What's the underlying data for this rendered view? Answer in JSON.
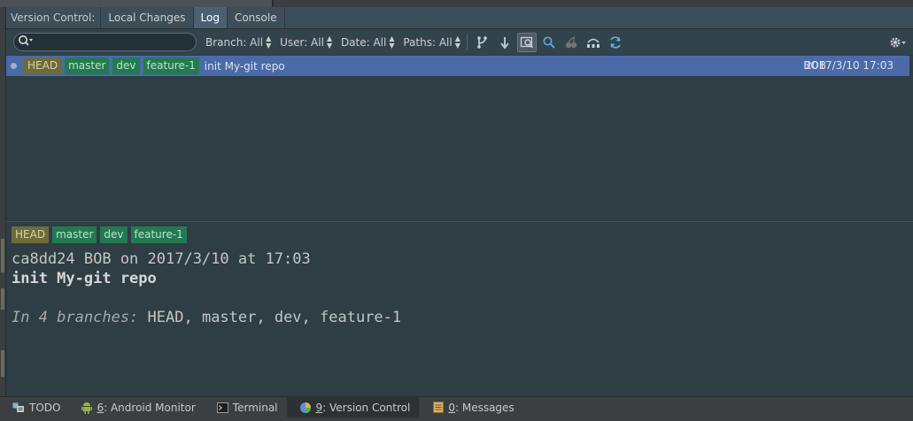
{
  "colors": {
    "selected_row": "#4a6aa8",
    "head_label": "#6f6a3a",
    "branch_label": "#237a50",
    "panel_bg": "#2f3d44",
    "tab_active": "#4a6174"
  },
  "tabs": {
    "title": "Version Control:",
    "items": [
      {
        "label": "Local Changes",
        "active": false
      },
      {
        "label": "Log",
        "active": true
      },
      {
        "label": "Console",
        "active": false
      }
    ]
  },
  "toolbar": {
    "search": {
      "value": "",
      "placeholder": ""
    },
    "filters": {
      "branch": "Branch: All",
      "user": "User: All",
      "date": "Date: All",
      "paths": "Paths: All"
    },
    "icons": [
      "branch-graph-icon",
      "sort-down-icon",
      "preview-icon",
      "find-icon",
      "cherry-pick-icon",
      "intellisort-icon",
      "refresh-icon",
      "settings-gear-icon"
    ]
  },
  "log": {
    "commits": [
      {
        "labels": {
          "head": "HEAD",
          "branches": [
            "master",
            "dev",
            "feature-1"
          ]
        },
        "message": "init My-git repo",
        "author": "BOB",
        "date": "2017/3/10 17:03"
      }
    ]
  },
  "details": {
    "labels": {
      "head": "HEAD",
      "branches": [
        "master",
        "dev",
        "feature-1"
      ]
    },
    "hash_line": "ca8dd24 BOB on 2017/3/10 at 17:03",
    "subject": "init My-git repo",
    "branches_prefix": "In 4 branches:",
    "branches_list": "HEAD, master, dev, feature-1"
  },
  "bottom_bar": {
    "items": [
      {
        "key": "",
        "label": "TODO",
        "active": false
      },
      {
        "key": "6",
        "label": ": Android Monitor",
        "active": false
      },
      {
        "key": "",
        "label": "Terminal",
        "active": false
      },
      {
        "key": "9",
        "label": ": Version Control",
        "active": true
      },
      {
        "key": "0",
        "label": ": Messages",
        "active": false
      }
    ]
  }
}
